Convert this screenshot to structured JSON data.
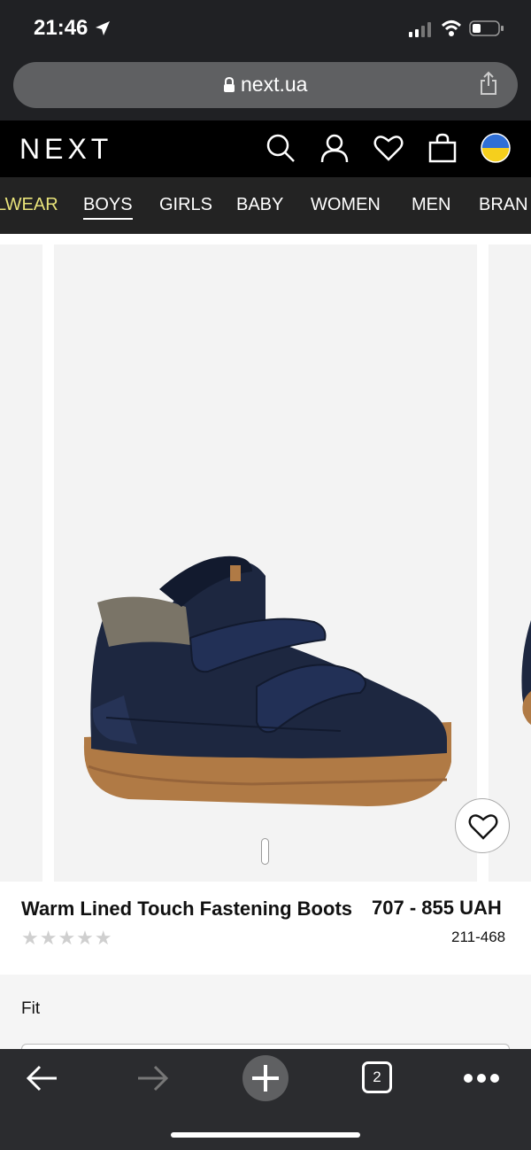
{
  "status": {
    "time": "21:46"
  },
  "browser": {
    "url": "next.ua",
    "tab_count": "2"
  },
  "header": {
    "logo": "NEXT"
  },
  "nav": {
    "items": [
      "LWEAR",
      "BOYS",
      "GIRLS",
      "BABY",
      "WOMEN",
      "MEN",
      "BRAN"
    ]
  },
  "product": {
    "title": "Warm Lined Touch Fastening Boots",
    "price": "707 - 855 UAH",
    "code": "211-468",
    "stars": "★★★★★",
    "rating_stars_filled": 0,
    "rating_stars_total": 5
  },
  "fit": {
    "label": "Fit"
  },
  "colors": {
    "accent_nav": "#e8e37a",
    "boot_navy": "#1d2740",
    "sole": "#b07a45",
    "flag_blue": "#2f6fd6",
    "flag_yellow": "#f5cf1d"
  }
}
